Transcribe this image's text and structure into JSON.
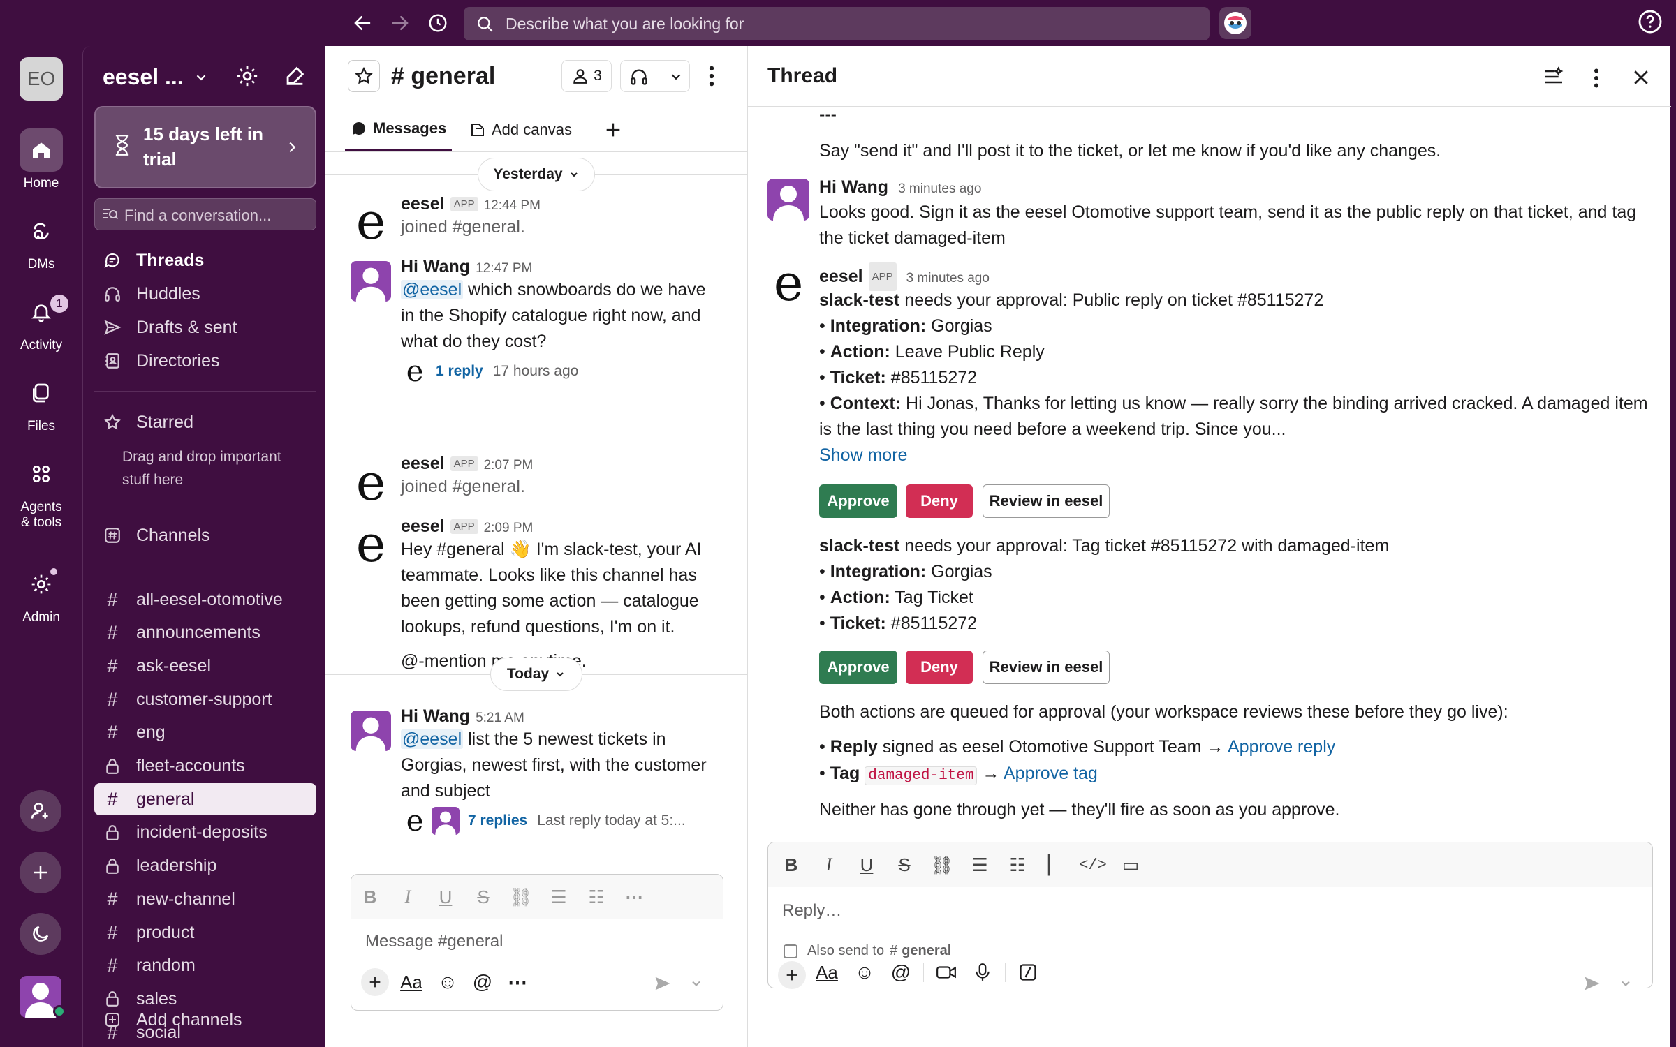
{
  "topbar": {
    "search_placeholder": "Describe what you are looking for"
  },
  "rail": {
    "workspace_initials": "EO",
    "home": "Home",
    "dms": "DMs",
    "activity": "Activity",
    "activity_badge": "1",
    "files": "Files",
    "agents_line1": "Agents",
    "agents_line2": "& tools",
    "admin": "Admin"
  },
  "sidebar": {
    "workspace_name": "eesel ...",
    "trial_line1": "15 days left in",
    "trial_line2": "trial",
    "find_placeholder": "Find a conversation...",
    "nav": [
      "Threads",
      "Huddles",
      "Drafts & sent",
      "Directories"
    ],
    "starred_label": "Starred",
    "starred_hint_1": "Drag and drop important",
    "starred_hint_2": "stuff here",
    "channels_label": "Channels",
    "channels": [
      {
        "name": "all-eesel-otomotive",
        "private": false
      },
      {
        "name": "announcements",
        "private": false
      },
      {
        "name": "ask-eesel",
        "private": false
      },
      {
        "name": "customer-support",
        "private": false
      },
      {
        "name": "eng",
        "private": false
      },
      {
        "name": "fleet-accounts",
        "private": true
      },
      {
        "name": "general",
        "private": false,
        "active": true
      },
      {
        "name": "incident-deposits",
        "private": true
      },
      {
        "name": "leadership",
        "private": true
      },
      {
        "name": "new-channel",
        "private": false
      },
      {
        "name": "product",
        "private": false
      },
      {
        "name": "random",
        "private": false
      },
      {
        "name": "sales",
        "private": true
      },
      {
        "name": "social",
        "private": false
      }
    ],
    "add_channels": "Add channels"
  },
  "channel": {
    "title": "# general",
    "member_count": "3",
    "tab_messages": "Messages",
    "tab_canvas": "Add canvas",
    "day_yesterday": "Yesterday",
    "day_today": "Today",
    "m1": {
      "name": "eesel",
      "badge": "APP",
      "time": "12:44 PM",
      "text": "joined #general."
    },
    "m2": {
      "name": "Hi Wang",
      "time": "12:47 PM",
      "mention": "@eesel",
      "text1": " which snowboards do we have",
      "text2": "in the Shopify catalogue right now, and",
      "text3": "what do they cost?",
      "replies": "1 reply",
      "replies_time": "17 hours ago"
    },
    "m3": {
      "name": "eesel",
      "badge": "APP",
      "time": "2:07 PM",
      "text": "joined #general."
    },
    "m4": {
      "name": "eesel",
      "badge": "APP",
      "time": "2:09 PM",
      "text1": "Hey #general 👋 I'm slack-test, your AI",
      "text2": "teammate. Looks like this channel has",
      "text3": "been getting some action — catalogue",
      "text4": "lookups, refund questions, I'm on it.",
      "text5": "@-mention me anytime."
    },
    "m5": {
      "name": "Hi Wang",
      "time": "5:21 AM",
      "mention": "@eesel",
      "text1": " list the 5 newest tickets in",
      "text2": "Gorgias, newest first, with the customer",
      "text3": "and subject",
      "replies": "7 replies",
      "replies_time": "Last reply today at 5:..."
    },
    "composer_placeholder": "Message #general"
  },
  "thread": {
    "title": "Thread",
    "top_dashes": "---",
    "top_line": "Say \"send it\" and I'll post it to the ticket, or let me know if you'd like any changes.",
    "hw": {
      "name": "Hi Wang",
      "time": "3 minutes ago",
      "line1": "Looks good. Sign it as the eesel Otomotive support team, send it as the public reply on that ticket, and tag",
      "line2": "the ticket damaged-item"
    },
    "bot": {
      "name": "eesel",
      "badge": "APP",
      "time": "3 minutes ago"
    },
    "a1": {
      "who": "slack-test",
      "head": " needs your approval: Public reply on ticket #85115272",
      "integration_k": "Integration:",
      "integration_v": " Gorgias",
      "action_k": "Action:",
      "action_v": " Leave Public Reply",
      "ticket_k": "Ticket:",
      "ticket_v": " #85115272",
      "context_k": "Context:",
      "context_v1": " Hi Jonas, Thanks for letting us know — really sorry the binding arrived cracked. A damaged item",
      "context_v2": "is the last thing you need before a weekend trip. Since you...",
      "show_more": "Show more"
    },
    "a2": {
      "who": "slack-test",
      "head": " needs your approval: Tag ticket #85115272 with damaged-item",
      "integration_k": "Integration:",
      "integration_v": " Gorgias",
      "action_k": "Action:",
      "action_v": " Tag Ticket",
      "ticket_k": "Ticket:",
      "ticket_v": " #85115272"
    },
    "approve": "Approve",
    "deny": "Deny",
    "review": "Review in eesel",
    "summary": "Both actions are queued for approval (your workspace reviews these before they go live):",
    "reply_k": "Reply",
    "reply_v": " signed as eesel Otomotive Support Team → ",
    "reply_link": "Approve reply",
    "tag_k": "Tag",
    "tag_code": "damaged-item",
    "tag_arrow": " → ",
    "tag_link": "Approve tag",
    "closing": "Neither has gone through yet — they'll fire as soon as you approve.",
    "reply_placeholder": "Reply…",
    "also_send": "Also send to",
    "also_channel": "general"
  },
  "colors": {
    "aubergine": "#3f0e40",
    "approve": "#2f7c51",
    "deny": "#d22e54",
    "link": "#1264a3"
  }
}
